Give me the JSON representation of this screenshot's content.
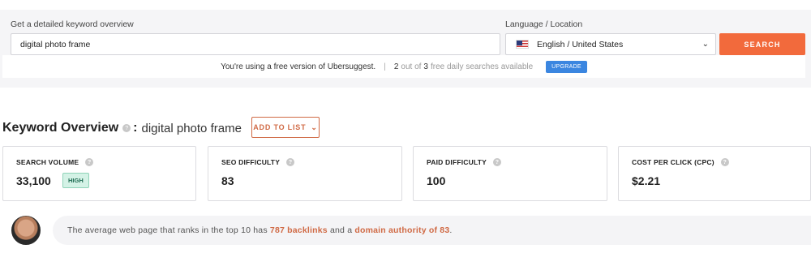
{
  "search": {
    "keyword_label": "Get a detailed keyword overview",
    "keyword_value": "digital photo frame",
    "language_label": "Language / Location",
    "language_value": "English / United States",
    "search_button": "SEARCH"
  },
  "free_notice": {
    "text": "You're using a free version of Ubersuggest.",
    "used": "2",
    "out_of": "out of",
    "total": "3",
    "rest": "free daily searches available",
    "upgrade_button": "UPGRADE"
  },
  "overview": {
    "title": "Keyword Overview",
    "colon": ":",
    "keyword": "digital photo frame",
    "add_to_list": "ADD TO LIST"
  },
  "metrics": [
    {
      "title": "SEARCH VOLUME",
      "value": "33,100",
      "badge": "HIGH"
    },
    {
      "title": "SEO DIFFICULTY",
      "value": "83"
    },
    {
      "title": "PAID DIFFICULTY",
      "value": "100"
    },
    {
      "title": "COST PER CLICK (CPC)",
      "value": "$2.21"
    }
  ],
  "tip": {
    "text_before": "The average web page that ranks in the top 10 has",
    "backlinks": "787 backlinks",
    "text_middle": "and a",
    "authority": "domain authority of 83",
    "text_after": "."
  },
  "colors": {
    "accent": "#f26a3c",
    "upgrade": "#3b86e0",
    "high_badge": "#d4f2e6"
  },
  "icons": {
    "flag": "us-flag-icon",
    "dropdown": "chevron-down-icon",
    "help": "question-icon",
    "avatar": "avatar"
  }
}
